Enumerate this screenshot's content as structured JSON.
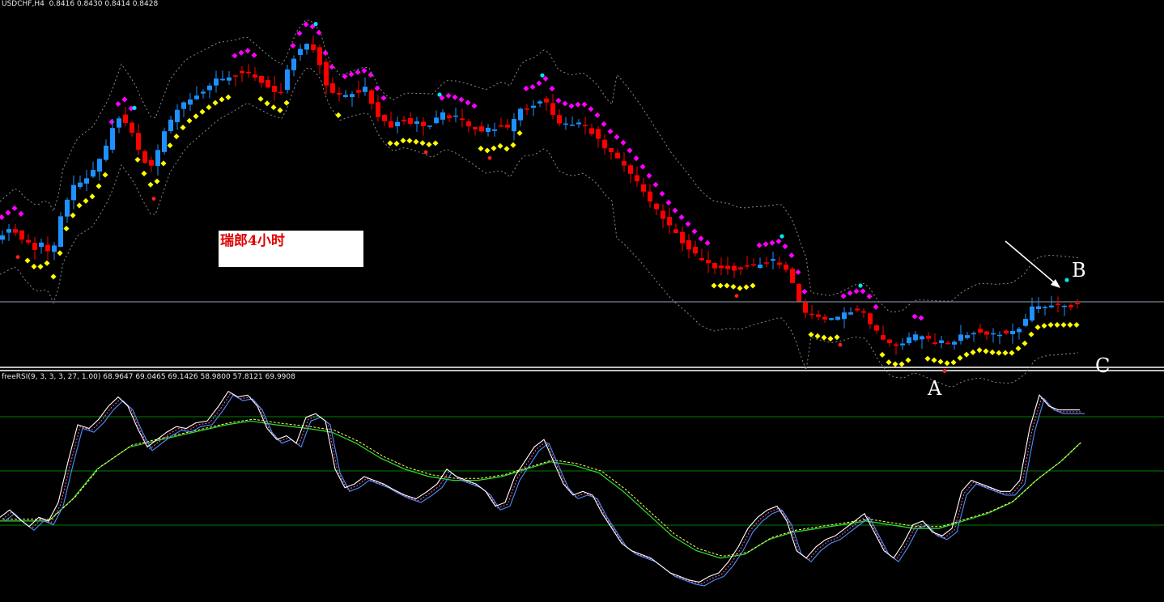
{
  "header": {
    "symbol": "USDCHF,H4",
    "open": "0.8416",
    "high": "0.8430",
    "low": "0.8414",
    "close": "0.8428"
  },
  "note": {
    "text": "瑞郎4小时"
  },
  "annotations": {
    "a": "A",
    "b": "B",
    "c": "C"
  },
  "indicator": {
    "label": "freeRSI(9, 3, 3, 3, 27, 1.00) 68.9647 69.0465 69.1426 58.9800 57.8121 69.9908"
  },
  "colors": {
    "background": "#000000",
    "bull_candle": "#1e90ff",
    "bear_candle": "#ff0000",
    "resistance_dots": "#ff00ff",
    "support_dots": "#ffff00",
    "top_signal": "#00e5ee",
    "bottom_signal": "#ff2020",
    "bands": "#8a8a8a",
    "rsi_main": "#ffffff",
    "rsi_signal": "#4a90ff",
    "rsi_dashed": "#ff60a0",
    "rsi_slow": "#30e030",
    "rsi_slow2": "#ffff60",
    "levels": "#008000"
  },
  "chart_data": [
    {
      "type": "candlestick",
      "symbol": "USDCHF",
      "timeframe": "H4",
      "ohlc_current": {
        "open": 0.8416,
        "high": 0.843,
        "low": 0.8414,
        "close": 0.8428
      },
      "price_path": [
        [
          0,
          0.2
        ],
        [
          10,
          0.22
        ],
        [
          20,
          0.24
        ],
        [
          30,
          0.2
        ],
        [
          45,
          0.16
        ],
        [
          58,
          0.18
        ],
        [
          68,
          0.12
        ],
        [
          78,
          0.28
        ],
        [
          95,
          0.38
        ],
        [
          115,
          0.42
        ],
        [
          135,
          0.52
        ],
        [
          150,
          0.64
        ],
        [
          165,
          0.58
        ],
        [
          178,
          0.5
        ],
        [
          190,
          0.44
        ],
        [
          210,
          0.6
        ],
        [
          230,
          0.68
        ],
        [
          250,
          0.72
        ],
        [
          270,
          0.76
        ],
        [
          290,
          0.78
        ],
        [
          305,
          0.8
        ],
        [
          320,
          0.77
        ],
        [
          335,
          0.74
        ],
        [
          350,
          0.72
        ],
        [
          365,
          0.84
        ],
        [
          380,
          0.9
        ],
        [
          395,
          0.86
        ],
        [
          405,
          0.76
        ],
        [
          420,
          0.7
        ],
        [
          440,
          0.72
        ],
        [
          455,
          0.73
        ],
        [
          470,
          0.64
        ],
        [
          485,
          0.6
        ],
        [
          500,
          0.62
        ],
        [
          520,
          0.61
        ],
        [
          535,
          0.6
        ],
        [
          550,
          0.64
        ],
        [
          565,
          0.63
        ],
        [
          580,
          0.61
        ],
        [
          600,
          0.58
        ],
        [
          620,
          0.6
        ],
        [
          630,
          0.58
        ],
        [
          645,
          0.66
        ],
        [
          660,
          0.67
        ],
        [
          675,
          0.7
        ],
        [
          690,
          0.62
        ],
        [
          705,
          0.6
        ],
        [
          720,
          0.61
        ],
        [
          735,
          0.58
        ],
        [
          750,
          0.52
        ],
        [
          770,
          0.47
        ],
        [
          790,
          0.4
        ],
        [
          810,
          0.32
        ],
        [
          830,
          0.24
        ],
        [
          850,
          0.18
        ],
        [
          865,
          0.13
        ],
        [
          880,
          0.1
        ],
        [
          900,
          0.1
        ],
        [
          915,
          0.09
        ],
        [
          930,
          0.1
        ],
        [
          950,
          0.11
        ],
        [
          965,
          0.12
        ],
        [
          980,
          0.06
        ],
        [
          995,
          -0.07
        ],
        [
          1010,
          -0.08
        ],
        [
          1025,
          -0.09
        ],
        [
          1040,
          -0.08
        ],
        [
          1055,
          -0.06
        ],
        [
          1070,
          -0.06
        ],
        [
          1085,
          -0.13
        ],
        [
          1100,
          -0.18
        ],
        [
          1115,
          -0.18
        ],
        [
          1130,
          -0.15
        ],
        [
          1145,
          -0.16
        ],
        [
          1160,
          -0.17
        ],
        [
          1175,
          -0.18
        ],
        [
          1190,
          -0.15
        ],
        [
          1210,
          -0.13
        ],
        [
          1230,
          -0.14
        ],
        [
          1250,
          -0.14
        ],
        [
          1265,
          -0.11
        ],
        [
          1280,
          -0.05
        ],
        [
          1295,
          -0.04
        ],
        [
          1310,
          -0.04
        ],
        [
          1325,
          -0.04
        ],
        [
          1337,
          -0.04
        ]
      ],
      "signals": {
        "top": [
          166,
          390,
          543,
          670,
          966,
          1063,
          1318
        ],
        "bottom": [
          22,
          190,
          526,
          605,
          910,
          1038,
          1167
        ]
      }
    },
    {
      "type": "line",
      "name": "freeRSI(9, 3, 3, 3, 27, 1.00)",
      "values_current": [
        68.9647,
        69.0465,
        69.1426,
        58.98,
        57.8121,
        69.9908
      ],
      "levels": [
        80,
        50,
        20
      ],
      "path": [
        [
          0,
          0.32
        ],
        [
          12,
          0.36
        ],
        [
          24,
          0.31
        ],
        [
          36,
          0.27
        ],
        [
          48,
          0.32
        ],
        [
          60,
          0.3
        ],
        [
          72,
          0.4
        ],
        [
          84,
          0.62
        ],
        [
          96,
          0.82
        ],
        [
          110,
          0.8
        ],
        [
          122,
          0.85
        ],
        [
          134,
          0.92
        ],
        [
          146,
          0.97
        ],
        [
          158,
          0.92
        ],
        [
          170,
          0.8
        ],
        [
          182,
          0.7
        ],
        [
          194,
          0.74
        ],
        [
          206,
          0.78
        ],
        [
          218,
          0.81
        ],
        [
          230,
          0.8
        ],
        [
          242,
          0.83
        ],
        [
          256,
          0.84
        ],
        [
          270,
          0.92
        ],
        [
          282,
          1.0
        ],
        [
          294,
          0.97
        ],
        [
          306,
          0.98
        ],
        [
          318,
          0.92
        ],
        [
          330,
          0.8
        ],
        [
          342,
          0.74
        ],
        [
          354,
          0.76
        ],
        [
          366,
          0.72
        ],
        [
          378,
          0.86
        ],
        [
          390,
          0.88
        ],
        [
          402,
          0.84
        ],
        [
          414,
          0.58
        ],
        [
          426,
          0.48
        ],
        [
          438,
          0.5
        ],
        [
          450,
          0.54
        ],
        [
          462,
          0.52
        ],
        [
          474,
          0.5
        ],
        [
          486,
          0.47
        ],
        [
          500,
          0.44
        ],
        [
          514,
          0.42
        ],
        [
          528,
          0.46
        ],
        [
          540,
          0.5
        ],
        [
          552,
          0.58
        ],
        [
          564,
          0.54
        ],
        [
          576,
          0.52
        ],
        [
          588,
          0.5
        ],
        [
          600,
          0.46
        ],
        [
          612,
          0.38
        ],
        [
          624,
          0.4
        ],
        [
          636,
          0.54
        ],
        [
          648,
          0.62
        ],
        [
          660,
          0.7
        ],
        [
          672,
          0.74
        ],
        [
          684,
          0.62
        ],
        [
          696,
          0.5
        ],
        [
          708,
          0.44
        ],
        [
          720,
          0.46
        ],
        [
          732,
          0.44
        ],
        [
          744,
          0.34
        ],
        [
          756,
          0.26
        ],
        [
          768,
          0.18
        ],
        [
          780,
          0.14
        ],
        [
          792,
          0.12
        ],
        [
          804,
          0.1
        ],
        [
          816,
          0.06
        ],
        [
          828,
          0.02
        ],
        [
          840,
          0.0
        ],
        [
          852,
          -0.02
        ],
        [
          864,
          -0.03
        ],
        [
          876,
          0.0
        ],
        [
          888,
          0.02
        ],
        [
          900,
          0.08
        ],
        [
          912,
          0.16
        ],
        [
          924,
          0.26
        ],
        [
          936,
          0.32
        ],
        [
          948,
          0.36
        ],
        [
          960,
          0.38
        ],
        [
          972,
          0.3
        ],
        [
          984,
          0.14
        ],
        [
          996,
          0.1
        ],
        [
          1008,
          0.16
        ],
        [
          1020,
          0.2
        ],
        [
          1032,
          0.22
        ],
        [
          1044,
          0.26
        ],
        [
          1056,
          0.3
        ],
        [
          1068,
          0.34
        ],
        [
          1080,
          0.24
        ],
        [
          1092,
          0.14
        ],
        [
          1104,
          0.1
        ],
        [
          1116,
          0.18
        ],
        [
          1128,
          0.28
        ],
        [
          1140,
          0.3
        ],
        [
          1152,
          0.24
        ],
        [
          1164,
          0.22
        ],
        [
          1176,
          0.26
        ],
        [
          1188,
          0.46
        ],
        [
          1200,
          0.52
        ],
        [
          1212,
          0.5
        ],
        [
          1224,
          0.48
        ],
        [
          1236,
          0.46
        ],
        [
          1248,
          0.46
        ],
        [
          1260,
          0.52
        ],
        [
          1272,
          0.8
        ],
        [
          1284,
          0.98
        ],
        [
          1296,
          0.92
        ],
        [
          1308,
          0.9
        ],
        [
          1320,
          0.9
        ],
        [
          1334,
          0.9
        ]
      ],
      "slow_path": [
        [
          0,
          0.3
        ],
        [
          60,
          0.3
        ],
        [
          90,
          0.42
        ],
        [
          120,
          0.58
        ],
        [
          160,
          0.7
        ],
        [
          200,
          0.74
        ],
        [
          240,
          0.78
        ],
        [
          280,
          0.82
        ],
        [
          310,
          0.84
        ],
        [
          340,
          0.82
        ],
        [
          380,
          0.8
        ],
        [
          410,
          0.78
        ],
        [
          440,
          0.72
        ],
        [
          470,
          0.64
        ],
        [
          500,
          0.58
        ],
        [
          530,
          0.54
        ],
        [
          560,
          0.52
        ],
        [
          590,
          0.52
        ],
        [
          620,
          0.54
        ],
        [
          650,
          0.58
        ],
        [
          680,
          0.62
        ],
        [
          710,
          0.6
        ],
        [
          740,
          0.56
        ],
        [
          770,
          0.46
        ],
        [
          800,
          0.34
        ],
        [
          830,
          0.22
        ],
        [
          860,
          0.14
        ],
        [
          890,
          0.1
        ],
        [
          920,
          0.12
        ],
        [
          950,
          0.2
        ],
        [
          980,
          0.24
        ],
        [
          1010,
          0.26
        ],
        [
          1040,
          0.28
        ],
        [
          1070,
          0.3
        ],
        [
          1100,
          0.28
        ],
        [
          1130,
          0.26
        ],
        [
          1160,
          0.26
        ],
        [
          1190,
          0.3
        ],
        [
          1220,
          0.34
        ],
        [
          1250,
          0.4
        ],
        [
          1280,
          0.52
        ],
        [
          1310,
          0.62
        ],
        [
          1334,
          0.72
        ]
      ]
    }
  ]
}
